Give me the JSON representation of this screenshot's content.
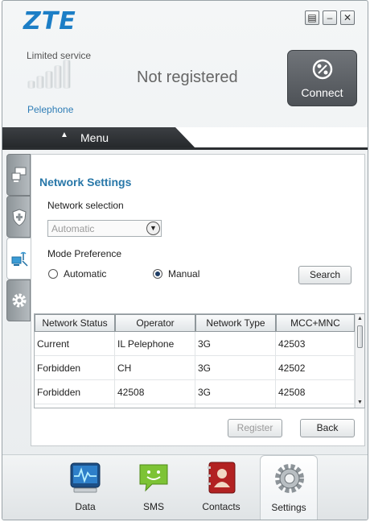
{
  "app": {
    "logo": "ZTE",
    "window_buttons": [
      {
        "name": "restore-icon",
        "glyph": "▤"
      },
      {
        "name": "minimize-icon",
        "glyph": "–"
      },
      {
        "name": "close-icon",
        "glyph": "✕"
      }
    ]
  },
  "status": {
    "service": "Limited service",
    "operator": "Pelephone",
    "registration": "Not registered",
    "signal_bars": 0,
    "connect_label": "Connect"
  },
  "menu": {
    "label": "Menu",
    "arrow": "▲"
  },
  "side_tabs": [
    {
      "name": "network-tab",
      "icon": "network-icon",
      "active": false
    },
    {
      "name": "security-tab",
      "icon": "shield-plus-icon",
      "active": false
    },
    {
      "name": "network-settings-tab",
      "icon": "network-antenna-icon",
      "active": true
    },
    {
      "name": "advanced-tab",
      "icon": "gear-icon",
      "active": false
    }
  ],
  "network_settings": {
    "title": "Network Settings",
    "network_selection_label": "Network selection",
    "network_selection_value": "Automatic",
    "mode_preference_label": "Mode Preference",
    "mode_options": [
      {
        "label": "Automatic",
        "selected": false
      },
      {
        "label": "Manual",
        "selected": true
      }
    ],
    "search_label": "Search",
    "table": {
      "headers": [
        "Network Status",
        "Operator",
        "Network Type",
        "MCC+MNC"
      ],
      "rows": [
        [
          "Current",
          "IL Pelephone",
          "3G",
          "42503"
        ],
        [
          "Forbidden",
          "CH",
          "3G",
          "42502"
        ],
        [
          "Forbidden",
          "42508",
          "3G",
          "42508"
        ]
      ]
    },
    "register_label": "Register",
    "back_label": "Back"
  },
  "bottom_nav": [
    {
      "label": "Data",
      "icon": "data-monitor-icon",
      "active": false
    },
    {
      "label": "SMS",
      "icon": "sms-icon",
      "active": false
    },
    {
      "label": "Contacts",
      "icon": "contacts-book-icon",
      "active": false
    },
    {
      "label": "Settings",
      "icon": "gear-icon",
      "active": true
    }
  ],
  "colors": {
    "brand": "#1c7ec6",
    "title_accent": "#2877a8",
    "operator_text": "#2f7db6",
    "connect_button": "#5e6267"
  }
}
